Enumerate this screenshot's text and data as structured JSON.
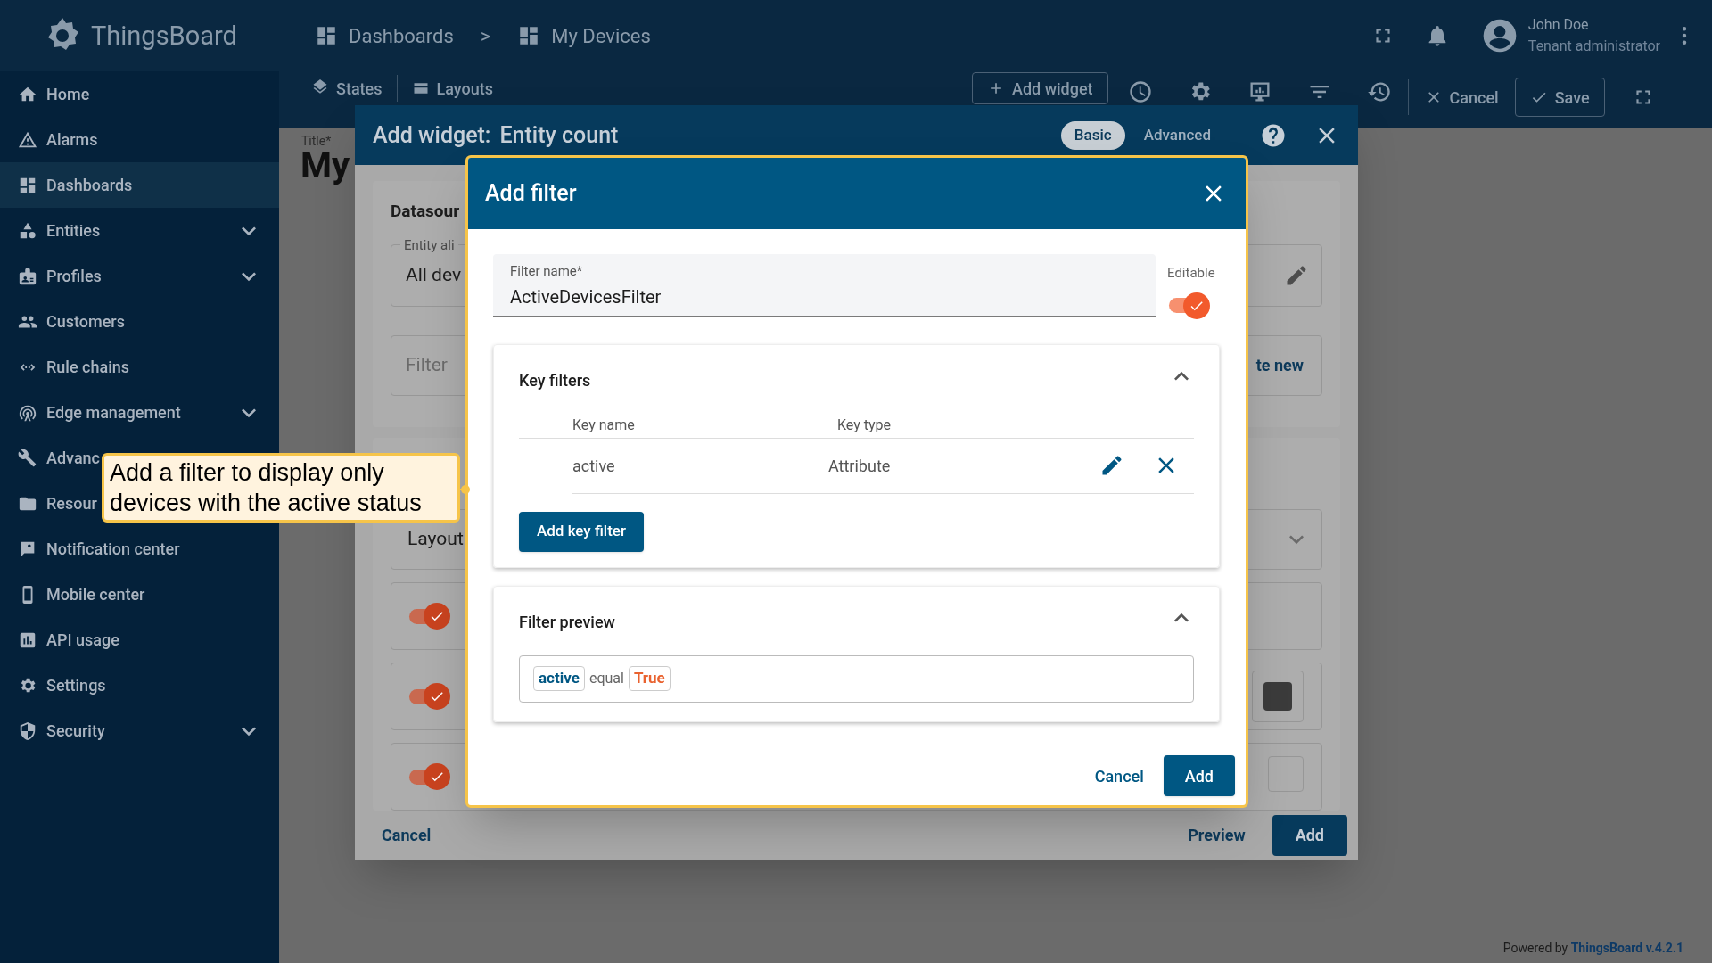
{
  "top_bar": {
    "logo_text": "ThingsBoard",
    "breadcrumbs": [
      "Dashboards",
      "My Devices"
    ],
    "separator": ">",
    "user": {
      "name": "John Doe",
      "role": "Tenant administrator"
    }
  },
  "sidebar": {
    "items": [
      {
        "label": "Home",
        "selected": false,
        "expandable": false
      },
      {
        "label": "Alarms",
        "selected": false,
        "expandable": false
      },
      {
        "label": "Dashboards",
        "selected": true,
        "expandable": false
      },
      {
        "label": "Entities",
        "selected": false,
        "expandable": true
      },
      {
        "label": "Profiles",
        "selected": false,
        "expandable": true
      },
      {
        "label": "Customers",
        "selected": false,
        "expandable": false
      },
      {
        "label": "Rule chains",
        "selected": false,
        "expandable": false
      },
      {
        "label": "Edge management",
        "selected": false,
        "expandable": true
      },
      {
        "label": "Advanc",
        "selected": false,
        "expandable": false
      },
      {
        "label": "Resour",
        "selected": false,
        "expandable": false
      },
      {
        "label": "Notification center",
        "selected": false,
        "expandable": false
      },
      {
        "label": "Mobile center",
        "selected": false,
        "expandable": false
      },
      {
        "label": "API usage",
        "selected": false,
        "expandable": false
      },
      {
        "label": "Settings",
        "selected": false,
        "expandable": false
      },
      {
        "label": "Security",
        "selected": false,
        "expandable": true
      }
    ]
  },
  "toolbar": {
    "states": "States",
    "layouts": "Layouts",
    "add_widget": "Add widget",
    "cancel": "Cancel",
    "save": "Save"
  },
  "page": {
    "title_label": "Title*",
    "title_value": "My"
  },
  "widget_dialog": {
    "title": "Add widget:",
    "subtitle": "Entity count",
    "modes": [
      {
        "label": "Basic",
        "selected": true
      },
      {
        "label": "Advanced",
        "selected": false
      }
    ],
    "datasource_heading": "Datasour",
    "entity_alias": {
      "label": "Entity ali",
      "value": "All dev"
    },
    "filter": {
      "placeholder": "Filter"
    },
    "create_new": "te new",
    "layout": {
      "value": "Layout"
    },
    "toggles": [
      {
        "on": true
      },
      {
        "on": true
      },
      {
        "on": true
      }
    ],
    "footer": {
      "cancel": "Cancel",
      "preview": "Preview",
      "add": "Add"
    }
  },
  "filter_dialog": {
    "title": "Add filter",
    "filter_name": {
      "label": "Filter name*",
      "value": "ActiveDevicesFilter"
    },
    "editable": {
      "label": "Editable",
      "on": true
    },
    "key_filters": {
      "title": "Key filters",
      "expanded": true,
      "columns": [
        "Key name",
        "Key type"
      ],
      "rows": [
        {
          "key_name": "active",
          "key_type": "Attribute"
        }
      ],
      "add_button": "Add key filter"
    },
    "filter_preview": {
      "title": "Filter preview",
      "expanded": true,
      "key": "active",
      "operator": "equal",
      "value": "True"
    },
    "buttons": {
      "cancel": "Cancel",
      "add": "Add"
    }
  },
  "callout": {
    "text": "Add a filter to display only devices with the active status"
  },
  "footer": {
    "powered_by": "Powered by",
    "brand": "ThingsBoard v.4.2.1"
  }
}
